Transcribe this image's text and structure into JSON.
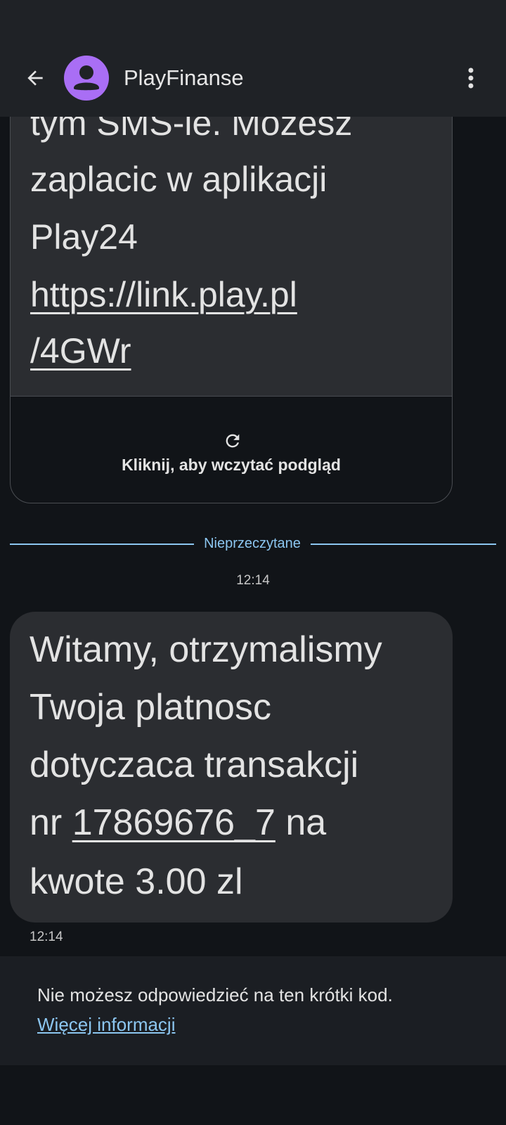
{
  "header": {
    "title": "PlayFinanse"
  },
  "message1": {
    "lines": [
      "tym SMS-ie. Mozesz",
      "zaplacic w aplikacji",
      "Play24"
    ],
    "link_lines": [
      "https://link.play.pl",
      "/4GWr"
    ],
    "preview_label": "Kliknij, aby wczytać podgląd"
  },
  "separator": {
    "unread_label": "Nieprzeczytane",
    "timestamp": "12:14"
  },
  "message2": {
    "line1": "Witamy, otrzymalismy",
    "line2": "Twoja platnosc",
    "line3": "dotyczaca transakcji",
    "line4_prefix": "nr ",
    "transaction_number": "17869676_7",
    "line4_suffix": " na",
    "line5": "kwote 3.00 zl",
    "timestamp": "12:14"
  },
  "footer": {
    "notice": "Nie możesz odpowiedzieć na ten krótki kod.",
    "more_info_link": "Więcej informacji"
  },
  "colors": {
    "background": "#111418",
    "bubble": "#2b2d31",
    "accent": "#8cc6f0",
    "avatar": "#a96ef5"
  },
  "icons": [
    "back-arrow-icon",
    "contact-avatar-icon",
    "more-vert-icon",
    "refresh-icon"
  ]
}
